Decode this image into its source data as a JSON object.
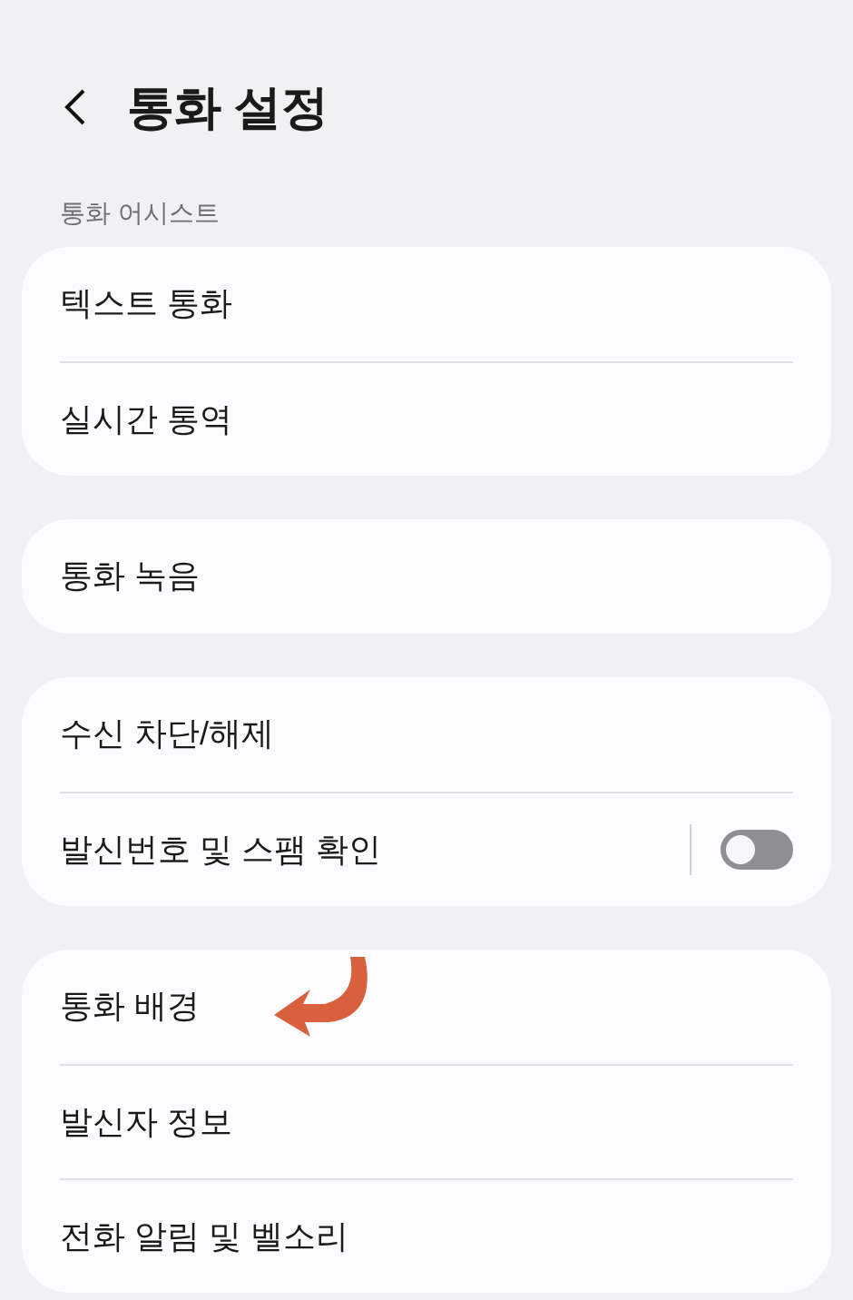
{
  "header": {
    "title": "통화 설정"
  },
  "groups": [
    {
      "section_label": "통화 어시스트",
      "items": [
        {
          "label": "텍스트 통화",
          "kind": "link"
        },
        {
          "label": "실시간 통역",
          "kind": "link"
        }
      ]
    },
    {
      "items": [
        {
          "label": "통화 녹음",
          "kind": "link"
        }
      ]
    },
    {
      "items": [
        {
          "label": "수신 차단/해제",
          "kind": "link"
        },
        {
          "label": "발신번호 및 스팸 확인",
          "kind": "toggle",
          "on": false
        }
      ]
    },
    {
      "items": [
        {
          "label": "통화 배경",
          "kind": "link",
          "annotated": true
        },
        {
          "label": "발신자 정보",
          "kind": "link"
        },
        {
          "label": "전화 알림 및 벨소리",
          "kind": "link"
        }
      ]
    }
  ]
}
